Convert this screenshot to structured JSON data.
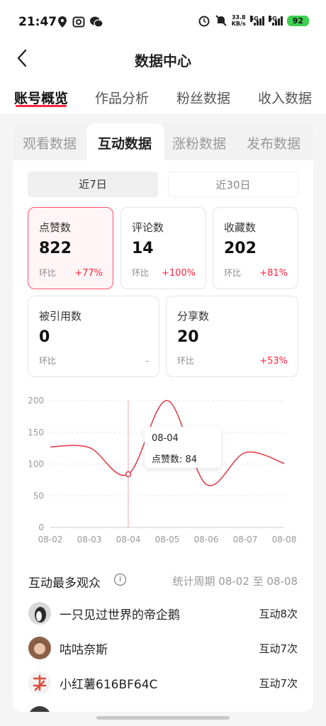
{
  "status_bar": {
    "time": "21:47",
    "icons": [
      "location-icon",
      "camera-icon",
      "wechat-icon"
    ],
    "right_icons": [
      "alarm-icon",
      "mute-icon"
    ],
    "net_speed_value": "33.8",
    "net_speed_unit": "KB/s",
    "signal1": "5G",
    "signal2": "5G",
    "battery": "92"
  },
  "nav": {
    "title": "数据中心",
    "back_icon": "back-chevron-icon"
  },
  "main_tabs": [
    {
      "label": "账号概览",
      "active": true
    },
    {
      "label": "作品分析",
      "active": false
    },
    {
      "label": "粉丝数据",
      "active": false
    },
    {
      "label": "收入数据",
      "active": false
    }
  ],
  "sub_tabs": [
    {
      "label": "观看数据",
      "active": false
    },
    {
      "label": "互动数据",
      "active": true
    },
    {
      "label": "涨粉数据",
      "active": false
    },
    {
      "label": "发布数据",
      "active": false
    }
  ],
  "date_ranges": [
    {
      "label": "近7日",
      "active": true
    },
    {
      "label": "近30日",
      "active": false
    }
  ],
  "metrics": [
    {
      "label": "点赞数",
      "value": "822",
      "compare_label": "环比",
      "change": "+77%",
      "active": true
    },
    {
      "label": "评论数",
      "value": "14",
      "compare_label": "环比",
      "change": "+100%",
      "active": false
    },
    {
      "label": "收藏数",
      "value": "202",
      "compare_label": "环比",
      "change": "+81%",
      "active": false
    },
    {
      "label": "被引用数",
      "value": "0",
      "compare_label": "环比",
      "change": "-",
      "active": false
    },
    {
      "label": "分享数",
      "value": "20",
      "compare_label": "环比",
      "change": "+53%",
      "active": false
    }
  ],
  "chart_data": {
    "type": "line",
    "categories": [
      "08-02",
      "08-03",
      "08-04",
      "08-05",
      "08-06",
      "08-07",
      "08-08"
    ],
    "series": [
      {
        "values": [
          127,
          126,
          84,
          200,
          68,
          118,
          101
        ]
      }
    ],
    "ylim": [
      0,
      200
    ],
    "yticks": [
      "0",
      "50",
      "100",
      "150",
      "200"
    ],
    "grid": true,
    "color": "#e0424f",
    "highlight_index": 2
  },
  "tooltip": {
    "date": "08-04",
    "text": "点赞数: 84"
  },
  "audience": {
    "title": "互动最多观众",
    "info_icon": "info-icon",
    "period": "统计周期 08-02 至 08-08",
    "items": [
      {
        "name": "一只见过世界的帝企鹅",
        "count": "互动8次",
        "avatar_color": "#2b2b2b"
      },
      {
        "name": "咕咕奈斯",
        "count": "互动7次",
        "avatar_color": "#c89a7a"
      },
      {
        "name": "小红薯616BF64C",
        "count": "互动7次",
        "avatar_color": "#e04a3a"
      }
    ]
  },
  "accent_color": "#ff2442"
}
